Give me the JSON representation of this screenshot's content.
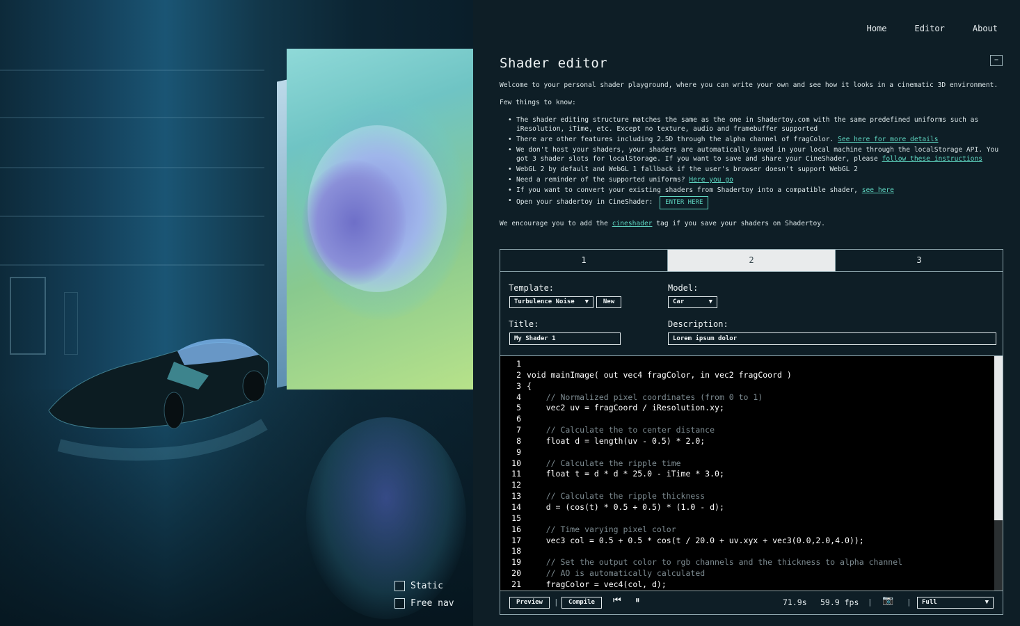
{
  "scene": {
    "toggles": [
      {
        "label": "Static",
        "checked": false
      },
      {
        "label": "Free nav",
        "checked": false
      }
    ]
  },
  "nav": {
    "items": [
      "Home",
      "Editor",
      "About"
    ]
  },
  "page": {
    "title": "Shader editor",
    "collapse_icon": "−",
    "welcome": "Welcome to your personal shader playground, where you can write your own and see how it looks in a cinematic 3D environment.",
    "few_things": "Few things to know:",
    "bullets": {
      "b1": "The shader editing structure matches the same as the one in Shadertoy.com with the same predefined uniforms such as iResolution, iTime, etc. Except no texture, audio and framebuffer supported",
      "b2_text": "There are other features including 2.5D through the alpha channel of fragColor. ",
      "b2_link": "See here for more details",
      "b3_text": "We don't host your shaders, your shaders are automatically saved in your local machine through the localStorage API. You got 3 shader slots for localStorage. If you want to save and share your CineShader, please ",
      "b3_link": "follow these instructions",
      "b4": "WebGL 2 by default and WebGL 1 fallback if the user's browser doesn't support WebGL 2",
      "b5_text": "Need a reminder of the supported uniforms? ",
      "b5_link": "Here you go",
      "b6_text": "If you want to convert your existing shaders from Shadertoy into a compatible shader, ",
      "b6_link": "see here",
      "b7_text": "Open your shadertoy in CineShader: ",
      "b7_button": "ENTER HERE"
    },
    "encourage_pre": "We encourage you to add the ",
    "encourage_link": "cineshader",
    "encourage_post": " tag if you save your shaders on Shadertoy."
  },
  "editor": {
    "tabs": [
      "1",
      "2",
      "3"
    ],
    "active_tab": 1,
    "template_label": "Template:",
    "template_value": "Turbulence Noise",
    "new_button": "New",
    "model_label": "Model:",
    "model_value": "Car",
    "title_label": "Title:",
    "title_value": "My Shader 1",
    "description_label": "Description:",
    "description_value": "Lorem ipsum dolor",
    "line_numbers": [
      "1",
      "2",
      "3",
      "4",
      "5",
      "6",
      "7",
      "8",
      "9",
      "10",
      "11",
      "12",
      "13",
      "14",
      "15",
      "16",
      "17",
      "18",
      "19",
      "20",
      "21"
    ],
    "code_lines": [
      "",
      "void mainImage( out vec4 fragColor, in vec2 fragCoord )",
      "{",
      "    // Normalized pixel coordinates (from 0 to 1)",
      "    vec2 uv = fragCoord / iResolution.xy;",
      "",
      "    // Calculate the to center distance",
      "    float d = length(uv - 0.5) * 2.0;",
      "",
      "    // Calculate the ripple time",
      "    float t = d * d * 25.0 - iTime * 3.0;",
      "",
      "    // Calculate the ripple thickness",
      "    d = (cos(t) * 0.5 + 0.5) * (1.0 - d);",
      "",
      "    // Time varying pixel color",
      "    vec3 col = 0.5 + 0.5 * cos(t / 20.0 + uv.xyx + vec3(0.0,2.0,4.0));",
      "",
      "    // Set the output color to rgb channels and the thickness to alpha channel",
      "    // AO is automatically calculated",
      "    fragColor = vec4(col, d);"
    ],
    "toolbar": {
      "preview": "Preview",
      "compile": "Compile",
      "time": "71.9s",
      "fps": "59.9 fps",
      "quality": "Full"
    }
  }
}
